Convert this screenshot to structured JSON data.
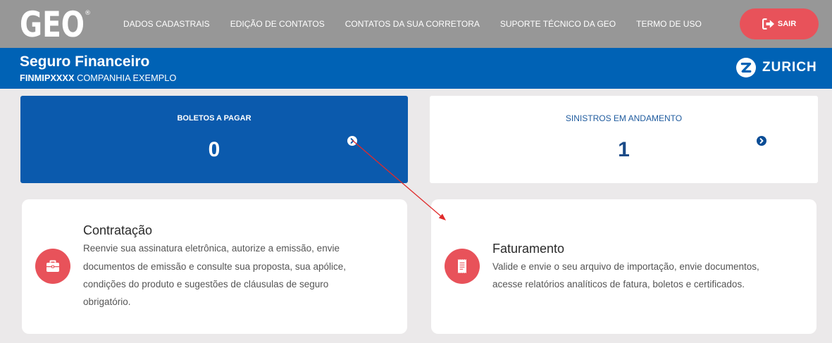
{
  "header": {
    "logo_text": "GEO",
    "logo_mark": "®",
    "nav_items": [
      {
        "label": "DADOS CADASTRAIS"
      },
      {
        "label": "EDIÇÃO DE CONTATOS"
      },
      {
        "label": "CONTATOS DA SUA CORRETORA"
      },
      {
        "label": "SUPORTE TÉCNICO DA GEO"
      },
      {
        "label": "TERMO DE USO"
      }
    ],
    "logout": {
      "label": "SAIR",
      "icon": "sign-out-icon"
    }
  },
  "banner": {
    "title": "Seguro Financeiro",
    "policy_code": "FINMIPXXXX",
    "company_name": "COMPANHIA EXEMPLO",
    "brand": {
      "name": "ZURICH",
      "icon": "zurich-logo-icon"
    }
  },
  "summary_cards": [
    {
      "title": "BOLETOS A PAGAR",
      "count": 0,
      "icon": "chevron-right-circle-icon"
    },
    {
      "title": "SINISTROS EM ANDAMENTO",
      "count": 1,
      "icon": "chevron-right-circle-icon"
    }
  ],
  "feature_cards": [
    {
      "title": "Contratação",
      "icon": "briefcase-icon",
      "description_lines": [
        "Reenvie sua assinatura eletrônica, autorize a emissão, envie",
        "documentos de emissão e consulte sua proposta, sua apólice,",
        "condições do produto e sugestões de cláusulas de seguro",
        "obrigatório."
      ]
    },
    {
      "title": "Faturamento",
      "icon": "receipt-icon",
      "description_lines": [
        "Valide e envie o seu arquivo de importação, envie documentos,",
        "acesse relatórios analíticos de fatura, boletos e certificados."
      ]
    }
  ],
  "colors": {
    "top_bar": "#979797",
    "banner": "#0062b5",
    "page_background": "#ebe9ea",
    "card_blue": "#0b5aad",
    "text_blue": "#1f5b9e",
    "accent_red": "#e8525a",
    "annotation_red": "#e02b2b"
  }
}
